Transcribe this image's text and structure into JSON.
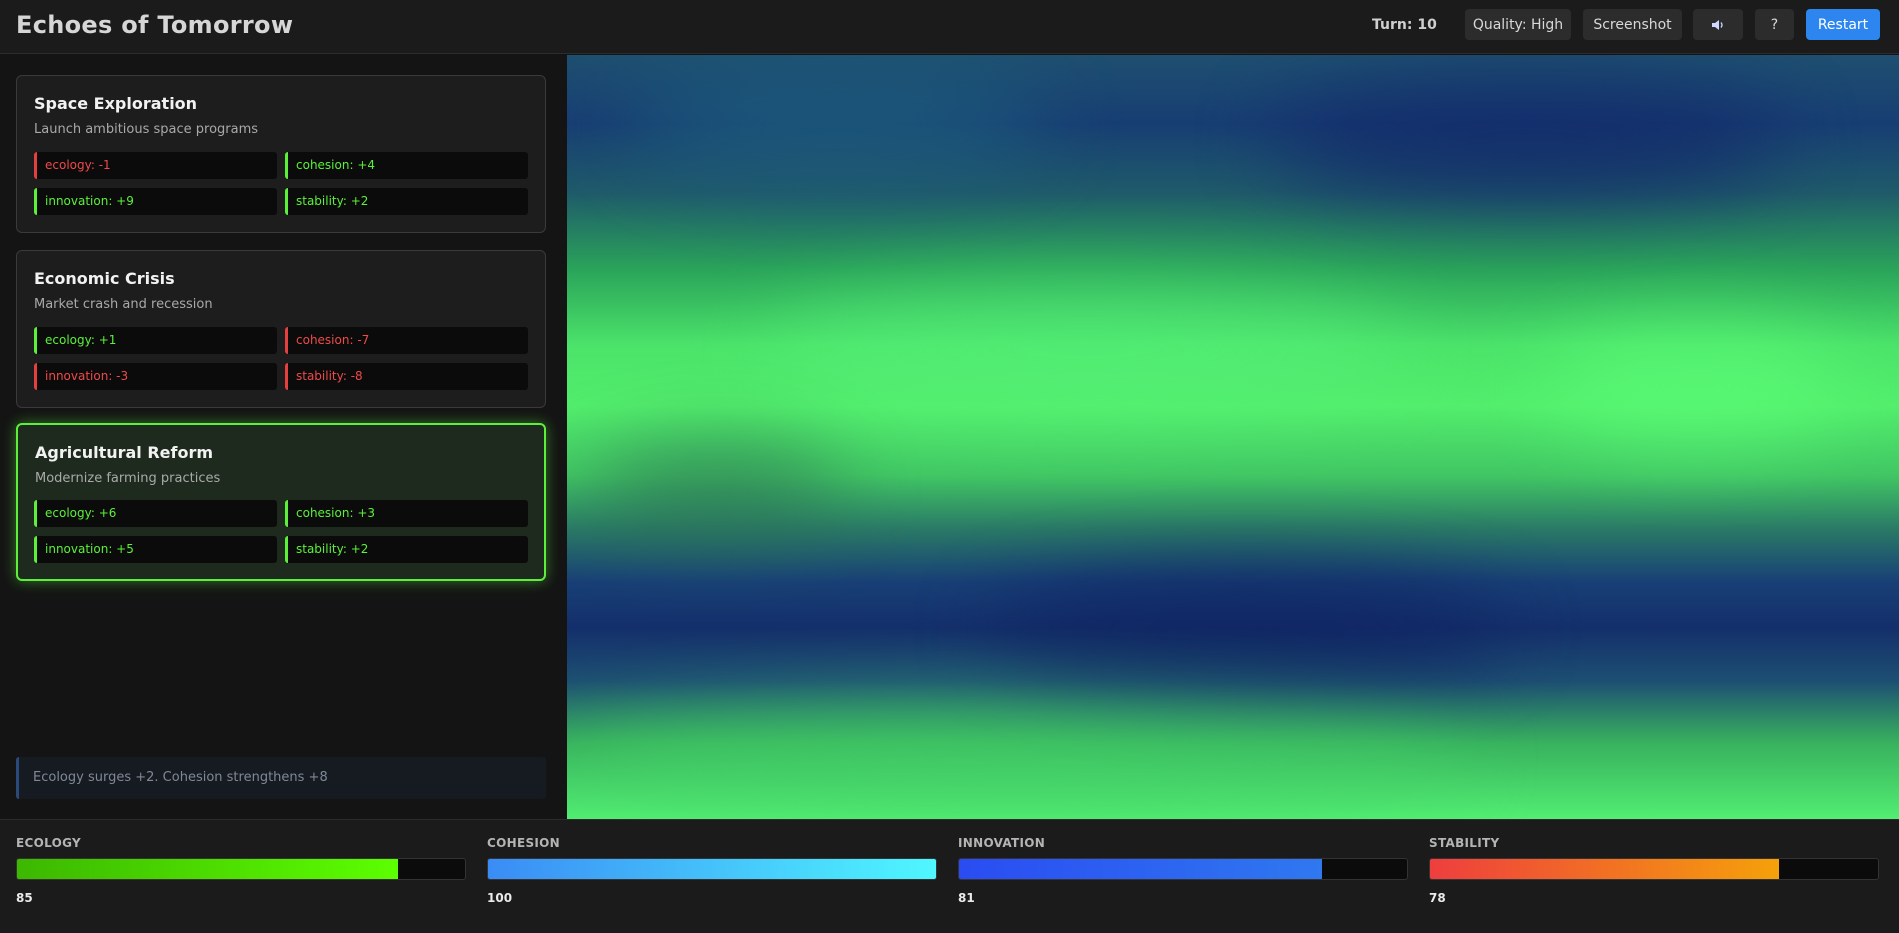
{
  "header": {
    "title": "Echoes of Tomorrow",
    "turn_label": "Turn: 10",
    "quality_label": "Quality: High",
    "screenshot_label": "Screenshot",
    "sound_icon": "speaker-icon",
    "help_label": "?",
    "restart_label": "Restart",
    "accent_color": "#2d86f0"
  },
  "cards": [
    {
      "title": "Space Exploration",
      "description": "Launch ambitious space programs",
      "selected": false,
      "effects": [
        {
          "label": "ecology: -1",
          "positive": false
        },
        {
          "label": "cohesion: +4",
          "positive": true
        },
        {
          "label": "innovation: +9",
          "positive": true
        },
        {
          "label": "stability: +2",
          "positive": true
        }
      ]
    },
    {
      "title": "Economic Crisis",
      "description": "Market crash and recession",
      "selected": false,
      "effects": [
        {
          "label": "ecology: +1",
          "positive": true
        },
        {
          "label": "cohesion: -7",
          "positive": false
        },
        {
          "label": "innovation: -3",
          "positive": false
        },
        {
          "label": "stability: -8",
          "positive": false
        }
      ]
    },
    {
      "title": "Agricultural Reform",
      "description": "Modernize farming practices",
      "selected": true,
      "effects": [
        {
          "label": "ecology: +6",
          "positive": true
        },
        {
          "label": "cohesion: +3",
          "positive": true
        },
        {
          "label": "innovation: +5",
          "positive": true
        },
        {
          "label": "stability: +2",
          "positive": true
        }
      ]
    }
  ],
  "log": {
    "message": "Ecology surges +2. Cohesion strengthens +8"
  },
  "stats": [
    {
      "label": "ECOLOGY",
      "value": 85,
      "display": "85",
      "color_start": "#3cb800",
      "color_end": "#5cff00"
    },
    {
      "label": "COHESION",
      "value": 100,
      "display": "100",
      "color_start": "#3a8cf5",
      "color_end": "#4ff7ff"
    },
    {
      "label": "INNOVATION",
      "value": 81,
      "display": "81",
      "color_start": "#2a4cf2",
      "color_end": "#2f78f0"
    },
    {
      "label": "STABILITY",
      "value": 78,
      "display": "78",
      "color_start": "#ee3e3e",
      "color_end": "#f5a10a"
    }
  ]
}
